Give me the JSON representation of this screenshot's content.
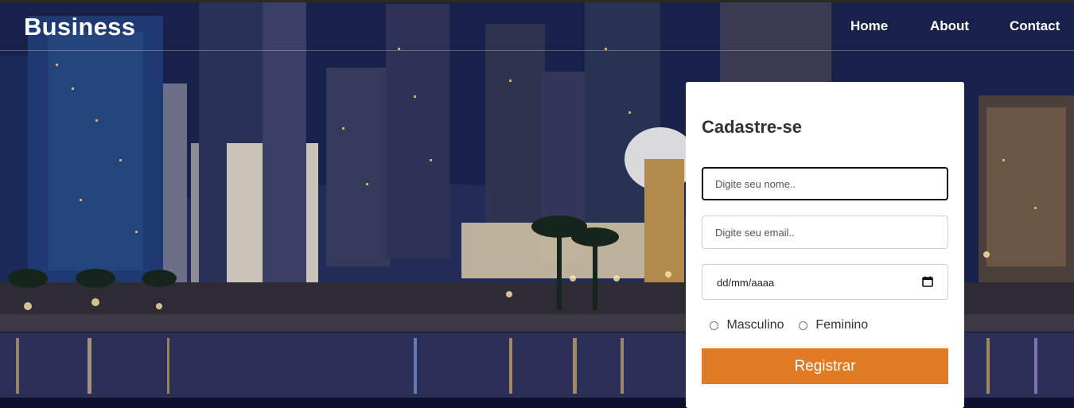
{
  "header": {
    "brand": "Business",
    "nav": [
      {
        "label": "Home"
      },
      {
        "label": "About"
      },
      {
        "label": "Contact"
      }
    ]
  },
  "form": {
    "title": "Cadastre-se",
    "name_placeholder": "Digite seu nome..",
    "email_placeholder": "Digite seu email..",
    "date_placeholder": "dd/mm/aaaa",
    "gender_options": [
      {
        "label": "Masculino"
      },
      {
        "label": "Feminino"
      }
    ],
    "submit_label": "Registrar"
  },
  "colors": {
    "accent": "#e07a23",
    "card": "#ffffff",
    "nav_text": "#ffffff"
  },
  "icons": {
    "date": "calendar-icon"
  }
}
